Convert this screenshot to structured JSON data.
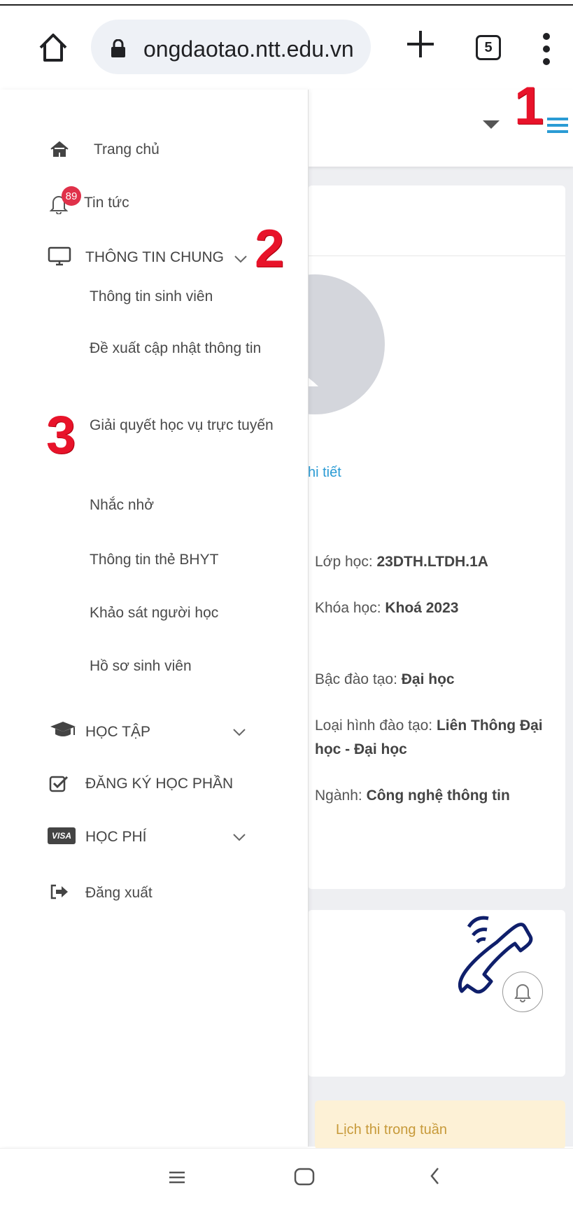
{
  "browser": {
    "url": "ongdaotao.ntt.edu.vn",
    "tab_count": "5"
  },
  "drawer": {
    "items": [
      {
        "label": "Trang chủ",
        "icon": "home-icon"
      },
      {
        "label": "Tin tức",
        "icon": "bell-icon",
        "badge": "89"
      },
      {
        "label": "THÔNG TIN CHUNG",
        "icon": "monitor-icon",
        "expanded": true
      }
    ],
    "sub_items": [
      "Thông tin sinh viên",
      "Đề xuất cập nhật thông tin",
      "Giải quyết học vụ trực tuyến",
      "Nhắc nhở",
      "Thông tin thẻ BHYT",
      "Khảo sát người học",
      "Hồ sơ sinh viên"
    ],
    "sections": [
      {
        "label": "HỌC TẬP",
        "icon": "graduation-cap-icon"
      },
      {
        "label": "ĐĂNG KÝ HỌC PHẦN",
        "icon": "checkbox-icon"
      },
      {
        "label": "HỌC PHÍ",
        "icon": "visa-card-icon"
      },
      {
        "label": "Đăng xuất",
        "icon": "logout-icon"
      }
    ]
  },
  "visa_text": "VISA",
  "annotations": [
    "1",
    "2",
    "3"
  ],
  "profile": {
    "detail_link": "hi tiết",
    "lop_label": "Lớp học: ",
    "lop_value": "23DTH.LTDH.1A",
    "khoa_label": "Khóa học: ",
    "khoa_value": "Khoá 2023",
    "bac_label": "Bậc đào tạo: ",
    "bac_value": "Đại học",
    "loai_label": "Loại hình đào tạo: ",
    "loai_value": "Liên Thông Đại học - Đại học",
    "nganh_label": "Ngành: ",
    "nganh_value": "Công nghệ thông tin"
  },
  "schedule_card": "Lịch thi trong tuần",
  "colors": {
    "annotation": "#e8132a",
    "badge": "#e0314a",
    "link": "#2a9bd4",
    "phone": "#0f1f6b"
  }
}
